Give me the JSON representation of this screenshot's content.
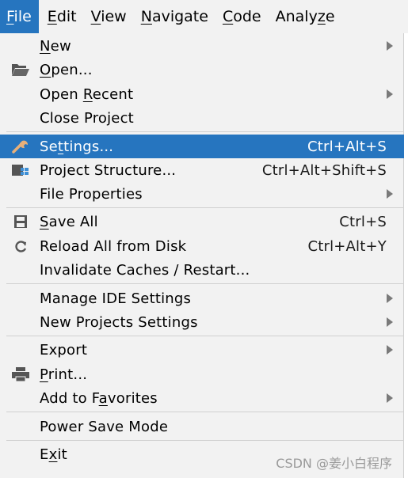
{
  "menubar": {
    "items": [
      {
        "label": "File",
        "mnemonic": "F",
        "active": true
      },
      {
        "label": "Edit",
        "mnemonic": "E"
      },
      {
        "label": "View",
        "mnemonic": "V"
      },
      {
        "label": "Navigate",
        "mnemonic": "N"
      },
      {
        "label": "Code",
        "mnemonic": "C"
      },
      {
        "label": "Analyze",
        "mnemonic": "z"
      }
    ]
  },
  "file_menu": {
    "items": [
      {
        "label": "New",
        "mnemonic": "N",
        "submenu": true
      },
      {
        "label": "Open...",
        "mnemonic": "O",
        "icon": "folder-open-icon"
      },
      {
        "label": "Open Recent",
        "mnemonic": "R",
        "submenu": true
      },
      {
        "label": "Close Project"
      },
      {
        "label": "Settings...",
        "mnemonic": "t",
        "shortcut": "Ctrl+Alt+S",
        "icon": "wrench-icon",
        "selected": true
      },
      {
        "label": "Project Structure...",
        "shortcut": "Ctrl+Alt+Shift+S",
        "icon": "project-structure-icon"
      },
      {
        "label": "File Properties",
        "submenu": true
      },
      {
        "label": "Save All",
        "mnemonic": "S",
        "shortcut": "Ctrl+S",
        "icon": "save-icon"
      },
      {
        "label": "Reload All from Disk",
        "shortcut": "Ctrl+Alt+Y",
        "icon": "reload-icon"
      },
      {
        "label": "Invalidate Caches / Restart..."
      },
      {
        "label": "Manage IDE Settings",
        "submenu": true
      },
      {
        "label": "New Projects Settings",
        "submenu": true
      },
      {
        "label": "Export",
        "submenu": true
      },
      {
        "label": "Print...",
        "mnemonic": "P",
        "icon": "printer-icon"
      },
      {
        "label": "Add to Favorites",
        "mnemonic": "a",
        "submenu": true
      },
      {
        "label": "Power Save Mode"
      },
      {
        "label": "Exit",
        "mnemonic": "x"
      }
    ]
  },
  "watermark": "CSDN @姜小白程序",
  "colors": {
    "accent": "#2675bf",
    "menu_bg": "#f2f2f2",
    "separator": "#d0d0d0"
  }
}
